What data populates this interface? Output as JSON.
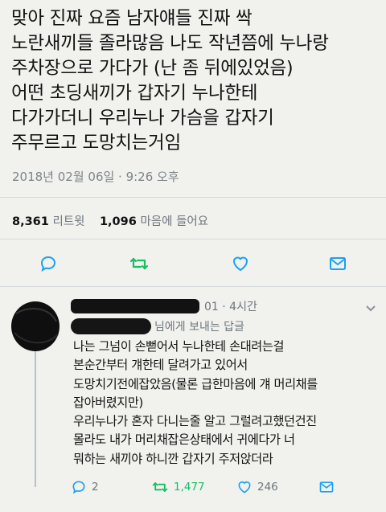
{
  "tweet": {
    "text": "맞아 진짜 요즘 남자얘들 진짜 싹\n노란새끼들 졸라많음 나도 작년쯤에 누나랑\n주차장으로 가다가 (난 좀 뒤에있었음)\n어떤 초딩새끼가 갑자기 누나한테\n다가가더니 우리누나 가슴을 갑자기\n주무르고 도망치는거임",
    "timestamp": "2018년 02월 06일 · 9:26 오후",
    "retweets_count": "8,361",
    "retweets_label": "리트윗",
    "likes_count": "1,096",
    "likes_label": "마음에 들어요"
  },
  "reply": {
    "time_text": "01 · 4시간",
    "replying_to": "님에게 보내는 답글",
    "text": "나는 그넘이 손뻗어서 누나한테 손대려는걸\n본순간부터 걔한테 달려가고 있어서\n도망치기전에잡았음(물론 급한마음에 걔 머리채를\n잡아버렸지만)\n우리누나가 혼자 다니는줄 알고 그럴려고했던건진\n몰라도 내가 머리채잡은상태에서 귀에다가 너\n뭐하는 새끼야 하니깐 갑자기 주저앉더라",
    "reply_count": "2",
    "retweet_count": "1,477",
    "like_count": "246"
  },
  "colors": {
    "background": "#f1f1ee",
    "muted_text": "#6e767c",
    "accent_blue": "#1da1f2",
    "retweet_green": "#17bf63",
    "divider": "#d7dadd"
  },
  "icons": [
    "reply-icon",
    "retweet-icon",
    "like-icon",
    "direct-message-icon",
    "chevron-down-icon"
  ]
}
